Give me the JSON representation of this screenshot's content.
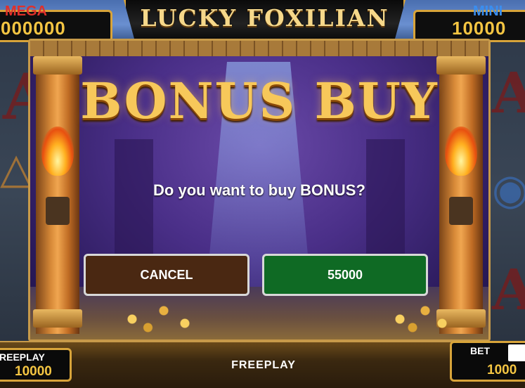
{
  "game": {
    "logo_title": "LUCKY FOXILIAN"
  },
  "jackpots": {
    "mega": {
      "label": "MEGA",
      "value": "000000"
    },
    "mini": {
      "label": "MINI",
      "value": "10000"
    }
  },
  "modal": {
    "title": "BONUS BUY",
    "question": "Do you want to buy BONUS?",
    "cancel_label": "CANCEL",
    "buy_label": "55000"
  },
  "bottom": {
    "freeplay_panel_label": "REEPLAY",
    "freeplay_panel_value": "10000",
    "center_label": "FREEPLAY",
    "bet_label": "BET",
    "bet_value": "1000"
  },
  "colors": {
    "gold": "#f4c542",
    "cancel_bg": "#4a2812",
    "buy_bg": "#0f6a24",
    "mega_red": "#e0302a",
    "mini_blue": "#3a8ef0"
  },
  "icons": [
    "torch-flame-icon",
    "coin-pile-icon"
  ]
}
